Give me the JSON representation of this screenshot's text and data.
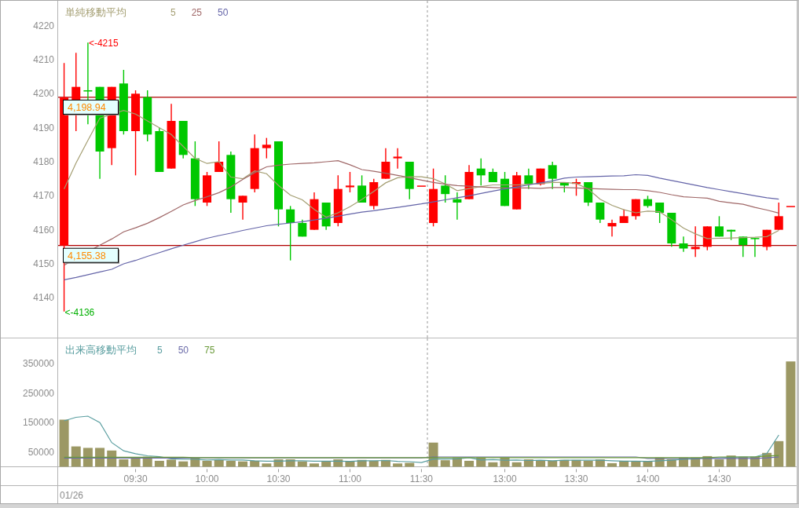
{
  "price_panel": {
    "chart_data": {
      "type": "candlestick",
      "title": "単純移動平均",
      "series": [
        {
          "ohlc": [
            [
              4155.4,
              4209,
              4136,
              4198.9
            ],
            [
              4198,
              4212,
              4189,
              4202
            ],
            [
              4201,
              4215,
              4191,
              4200.8
            ],
            [
              4202,
              4202,
              4175,
              4183
            ],
            [
              4184,
              4202,
              4179,
              4202
            ],
            [
              4203,
              4207,
              4188,
              4189
            ],
            [
              4189,
              4201,
              4176,
              4200
            ],
            [
              4199,
              4201,
              4186,
              4188
            ],
            [
              4189,
              4190,
              4177,
              4177
            ],
            [
              4178,
              4197,
              4178,
              4192
            ],
            [
              4192,
              4192,
              4181,
              4182
            ],
            [
              4181,
              4186,
              4167,
              4169
            ],
            [
              4168,
              4177,
              4167,
              4176
            ],
            [
              4177,
              4186,
              4177,
              4180
            ],
            [
              4182,
              4183,
              4165,
              4169
            ],
            [
              4168,
              4170,
              4163,
              4170
            ],
            [
              4172,
              4188,
              4171,
              4184
            ],
            [
              4184,
              4187,
              4181,
              4185
            ],
            [
              4186,
              4186,
              4161,
              4166
            ],
            [
              4166,
              4167,
              4151,
              4162
            ],
            [
              4162,
              4163,
              4158,
              4158
            ],
            [
              4160,
              4171,
              4160,
              4169
            ],
            [
              4168,
              4168,
              4160,
              4161
            ],
            [
              4162,
              4176,
              4161,
              4172
            ],
            [
              4172.5,
              4177,
              4171,
              4173
            ],
            [
              4173,
              4176,
              4168,
              4168
            ],
            [
              4167,
              4175,
              4166,
              4174
            ],
            [
              4175,
              4184,
              4175,
              4180
            ],
            [
              4181,
              4184,
              4178,
              4181.5
            ],
            [
              4180,
              4180,
              4169,
              4172
            ],
            [
              4173,
              4173,
              4173,
              4173
            ],
            [
              4162,
              4178,
              4161,
              4172
            ],
            [
              4173,
              4176,
              4168,
              4170.5
            ],
            [
              4169,
              4171,
              4163,
              4168
            ],
            [
              4169,
              4179,
              4169,
              4177
            ],
            [
              4178,
              4181,
              4173,
              4176
            ],
            [
              4177,
              4178,
              4174,
              4174
            ],
            [
              4175,
              4177,
              4167,
              4167
            ],
            [
              4166,
              4177,
              4166,
              4176
            ],
            [
              4176,
              4178,
              4172,
              4173.4
            ],
            [
              4173.4,
              4178,
              4173,
              4178
            ],
            [
              4179,
              4180,
              4172,
              4175
            ],
            [
              4174,
              4174,
              4171,
              4173
            ],
            [
              4173.5,
              4175,
              4170,
              4174
            ],
            [
              4174,
              4174,
              4167,
              4168
            ],
            [
              4168,
              4168,
              4162,
              4163
            ],
            [
              4161,
              4163,
              4158,
              4162
            ],
            [
              4162,
              4166,
              4162,
              4164
            ],
            [
              4164,
              4169,
              4163,
              4169
            ],
            [
              4169,
              4170,
              4166.5,
              4167
            ],
            [
              4168,
              4168,
              4162,
              4165
            ],
            [
              4165,
              4165,
              4155,
              4156
            ],
            [
              4156,
              4158,
              4153.5,
              4154.5
            ],
            [
              4154.3,
              4161,
              4152,
              4155
            ],
            [
              4155,
              4161,
              4154,
              4161
            ],
            [
              4161,
              4164,
              4158,
              4158
            ],
            [
              4160,
              4160,
              4157,
              4159.5
            ],
            [
              4158,
              4158,
              4152,
              4155.5
            ],
            [
              4157.6,
              4157.6,
              4152,
              4157.5
            ],
            [
              4155,
              4160,
              4154,
              4160
            ],
            [
              4160,
              4168,
              4160,
              4164
            ],
            [
              4167,
              4167,
              4167,
              4167
            ]
          ]
        },
        {
          "name": "5",
          "type": "line",
          "color": "#a49e72",
          "values": [
            4172,
            4179.6,
            4186.3,
            4192.8,
            null,
            4195.1,
            4194,
            4192,
            4190,
            4188,
            4184.5,
            4181,
            4179.5,
            4180,
            4175.5,
            4175,
            4177.3,
            4176.5,
            4173,
            4170.2,
            4168.8,
            4166,
            4163.7,
            4165,
            4166.8,
            4168.9,
            4171.3,
            4173.8,
            4175.3,
            4175.6,
            4175.6,
            4175,
            4173.5,
            4171.5,
            4172.1,
            4172.7,
            4173.2,
            4173.2,
            4173.2,
            4173.4,
            4173.6,
            4173.9,
            4173.9,
            4173.6,
            4172,
            4169,
            4167.2,
            4165.9,
            4165,
            4165.5,
            4165.3,
            4163,
            4160.5,
            4158.8,
            4157.4,
            4157.5,
            4157.6,
            4157.7,
            4157.8,
            4158,
            4159.8,
            null
          ]
        },
        {
          "name": "25",
          "type": "line",
          "color": "#a06868",
          "values": [
            4149.6,
            null,
            null,
            4155.5,
            4157.3,
            4159.4,
            4160.6,
            4161.9,
            4163.6,
            4165.4,
            4167.3,
            4168.6,
            4169.7,
            4170.9,
            4172.6,
            4174.8,
            4176.8,
            4178.5,
            4179,
            4179.3,
            4179.5,
            4179.7,
            4180,
            4180.3,
            4179.1,
            4177.7,
            4177.2,
            4176.6,
            4176,
            4175.3,
            4174.6,
            4173.9,
            4173.4,
            4173,
            4172.8,
            4172.6,
            4172.4,
            4172.3,
            4172.3,
            4172.3,
            4172.2,
            4172.4,
            4172.4,
            4172.3,
            4172.1,
            4172,
            4171.9,
            4171.8,
            4171.8,
            4171.5,
            4171,
            4170.3,
            4169.7,
            4169.5,
            4169.3,
            4168.4,
            4167.9,
            4167.5,
            4166.6,
            4165.8,
            4164.9,
            null
          ]
        },
        {
          "name": "50",
          "type": "line",
          "color": "#6464a8",
          "values": [
            4145.3,
            4146,
            4146.8,
            4147.6,
            4148.4,
            4150,
            4151,
            4152.2,
            4153.3,
            4154.4,
            4155.5,
            4156.5,
            4157.5,
            4158.3,
            4159,
            4159.8,
            4160.5,
            4161.2,
            4161.6,
            4162,
            4162.4,
            4162.9,
            4163.4,
            4164,
            4164.6,
            4165.2,
            4165.6,
            4166.1,
            4166.6,
            4167.1,
            4167.6,
            4168.2,
            4168.8,
            4169.4,
            4170,
            4170.7,
            4171.4,
            4172,
            4172.6,
            4173.2,
            4173.8,
            4174.4,
            4175.2,
            4175.5,
            4175.6,
            4175.7,
            4175.8,
            4175.9,
            4176.2,
            4176,
            4175.2,
            4174.5,
            4173.8,
            4173.1,
            4172.4,
            4171.8,
            4171.2,
            4170.6,
            4170,
            4169.4,
            4169,
            null
          ]
        }
      ],
      "ylim": [
        4128.2,
        4227.3
      ],
      "yticks": [
        4140,
        4150,
        4160,
        4170,
        4180,
        4190,
        4200,
        4210,
        4220
      ],
      "ref_lines": [
        {
          "axis": "y",
          "value": 4198.94,
          "label": "4,198.94"
        },
        {
          "axis": "y",
          "value": 4155.38,
          "label": "4,155.38"
        }
      ],
      "annotations": [
        "<-4215",
        "<-4136"
      ]
    }
  },
  "volume_panel": {
    "chart_data": {
      "type": "bar",
      "title": "出来高移動平均",
      "categories": [
        null,
        null,
        null,
        null,
        null,
        null,
        "09:30",
        null,
        null,
        null,
        null,
        null,
        "10:00",
        null,
        null,
        null,
        null,
        null,
        "10:30",
        null,
        null,
        null,
        null,
        null,
        "11:00",
        null,
        null,
        null,
        null,
        null,
        "11:30",
        null,
        null,
        null,
        null,
        null,
        null,
        "13:00",
        null,
        null,
        null,
        null,
        null,
        "13:30",
        null,
        null,
        null,
        null,
        null,
        "14:00",
        null,
        null,
        null,
        null,
        null,
        "14:30",
        null,
        null,
        null,
        null,
        null,
        null
      ],
      "series": [
        {
          "color": "#9c9864",
          "values": [
            160000,
            69000,
            64000,
            64000,
            55000,
            25000,
            31000,
            34000,
            20000,
            24000,
            18000,
            31000,
            20000,
            25000,
            20000,
            18000,
            20000,
            11000,
            25000,
            25000,
            18000,
            11000,
            17000,
            25000,
            18000,
            23000,
            20000,
            23000,
            11000,
            13000,
            null,
            82000,
            22000,
            30000,
            20000,
            31000,
            15000,
            31000,
            15000,
            25000,
            20000,
            20000,
            23000,
            23000,
            20000,
            25000,
            12000,
            20000,
            18000,
            18000,
            31000,
            25000,
            31000,
            31000,
            36000,
            25000,
            38000,
            34000,
            34000,
            47000,
            87000,
            358000
          ]
        },
        {
          "name": "5",
          "type": "line",
          "color": "#5a9ea0",
          "values": [
            156000,
            168000,
            172000,
            150000,
            82000,
            54000,
            44000,
            37000,
            34000,
            27000,
            25000,
            25000,
            23000,
            24000,
            23000,
            23000,
            20000,
            19000,
            19000,
            20000,
            20000,
            19000,
            19000,
            19000,
            18000,
            20000,
            20000,
            21000,
            18000,
            17000,
            14000,
            26000,
            26000,
            27000,
            31000,
            23000,
            24000,
            22000,
            23000,
            21000,
            22000,
            20000,
            22000,
            22000,
            22000,
            22000,
            20000,
            19000,
            19000,
            18000,
            20000,
            22000,
            25000,
            27000,
            31000,
            30000,
            32000,
            33000,
            33000,
            45000,
            108000,
            null
          ]
        },
        {
          "name": "50",
          "type": "line",
          "color": "#6a6aa8",
          "values": [
            29000,
            29000,
            29000,
            29000,
            29000,
            29000,
            29000,
            29000,
            29000,
            29000,
            29000,
            30000,
            30000,
            30000,
            30000,
            30000,
            30000,
            30000,
            30000,
            30000,
            30000,
            30000,
            30000,
            30000,
            30000,
            30000,
            30000,
            30000,
            30000,
            30000,
            30000,
            33000,
            33000,
            33000,
            33000,
            33000,
            33000,
            33000,
            33000,
            33000,
            33000,
            33000,
            33000,
            33000,
            33000,
            33000,
            33000,
            33000,
            33000,
            28000,
            28000,
            28000,
            28000,
            28000,
            28000,
            28000,
            28000,
            28000,
            28000,
            30000,
            33000,
            null
          ]
        },
        {
          "name": "75",
          "type": "line",
          "color": "#6a9a3a",
          "values": [
            32000,
            32000,
            32000,
            32000,
            32000,
            32000,
            32000,
            32000,
            32000,
            32000,
            32000,
            31000,
            31000,
            31000,
            31000,
            31000,
            31000,
            31000,
            31000,
            31000,
            31000,
            31000,
            31000,
            31000,
            31000,
            31000,
            31000,
            31000,
            31000,
            31000,
            31000,
            31000,
            31000,
            31000,
            31000,
            31000,
            31000,
            31000,
            31000,
            31000,
            31000,
            31000,
            31000,
            31000,
            31000,
            31000,
            31000,
            31000,
            31000,
            31000,
            31000,
            31000,
            31000,
            31000,
            31000,
            33000,
            33000,
            33000,
            33000,
            36000,
            38000,
            null
          ]
        }
      ],
      "ylim": [
        0,
        431000
      ],
      "yticks": [
        50000,
        150000,
        250000,
        350000
      ]
    }
  },
  "date_row": {
    "date": "01/26"
  }
}
